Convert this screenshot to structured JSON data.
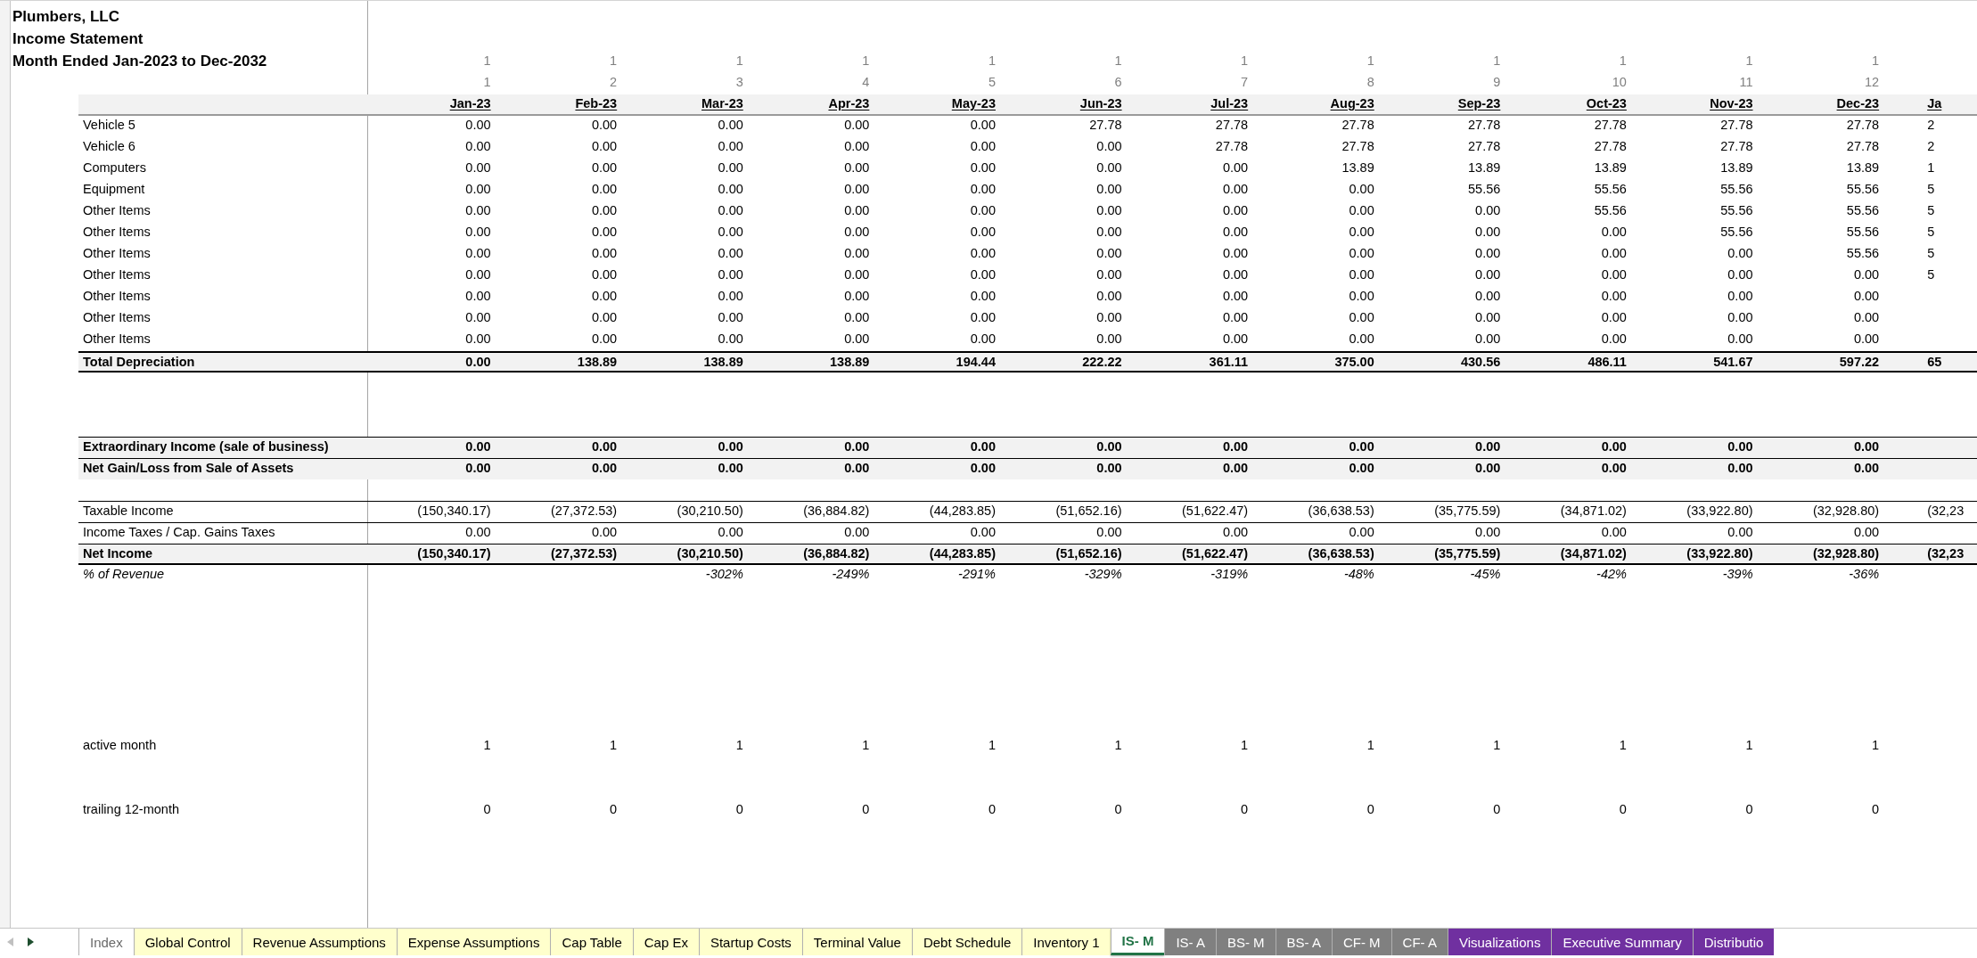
{
  "title_lines": [
    "Plumbers, LLC",
    "Income Statement",
    "Month Ended Jan-2023 to Dec-2032"
  ],
  "sections": [
    {
      "rows": [
        {
          "kind": "index",
          "values": [
            "1",
            "1",
            "1",
            "1",
            "1",
            "1",
            "1",
            "1",
            "1",
            "1",
            "1",
            "1"
          ]
        },
        {
          "kind": "index",
          "values": [
            "1",
            "2",
            "3",
            "4",
            "5",
            "6",
            "7",
            "8",
            "9",
            "10",
            "11",
            "12"
          ]
        },
        {
          "kind": "header",
          "values": [
            "Jan-23",
            "Feb-23",
            "Mar-23",
            "Apr-23",
            "May-23",
            "Jun-23",
            "Jul-23",
            "Aug-23",
            "Sep-23",
            "Oct-23",
            "Nov-23",
            "Dec-23"
          ],
          "cut_value": "Ja"
        }
      ]
    },
    {
      "rows": [
        {
          "kind": "item",
          "label": "Vehicle 5",
          "values": [
            "0.00",
            "0.00",
            "0.00",
            "0.00",
            "0.00",
            "27.78",
            "27.78",
            "27.78",
            "27.78",
            "27.78",
            "27.78",
            "27.78"
          ],
          "cut_value": "2"
        },
        {
          "kind": "item",
          "label": "Vehicle 6",
          "values": [
            "0.00",
            "0.00",
            "0.00",
            "0.00",
            "0.00",
            "0.00",
            "27.78",
            "27.78",
            "27.78",
            "27.78",
            "27.78",
            "27.78"
          ],
          "cut_value": "2"
        },
        {
          "kind": "item",
          "label": "Computers",
          "values": [
            "0.00",
            "0.00",
            "0.00",
            "0.00",
            "0.00",
            "0.00",
            "0.00",
            "13.89",
            "13.89",
            "13.89",
            "13.89",
            "13.89"
          ],
          "cut_value": "1"
        },
        {
          "kind": "item",
          "label": "Equipment",
          "values": [
            "0.00",
            "0.00",
            "0.00",
            "0.00",
            "0.00",
            "0.00",
            "0.00",
            "0.00",
            "55.56",
            "55.56",
            "55.56",
            "55.56"
          ],
          "cut_value": "5"
        },
        {
          "kind": "item",
          "label": "Other Items",
          "values": [
            "0.00",
            "0.00",
            "0.00",
            "0.00",
            "0.00",
            "0.00",
            "0.00",
            "0.00",
            "0.00",
            "55.56",
            "55.56",
            "55.56"
          ],
          "cut_value": "5"
        },
        {
          "kind": "item",
          "label": "Other Items",
          "values": [
            "0.00",
            "0.00",
            "0.00",
            "0.00",
            "0.00",
            "0.00",
            "0.00",
            "0.00",
            "0.00",
            "0.00",
            "55.56",
            "55.56"
          ],
          "cut_value": "5"
        },
        {
          "kind": "item",
          "label": "Other Items",
          "values": [
            "0.00",
            "0.00",
            "0.00",
            "0.00",
            "0.00",
            "0.00",
            "0.00",
            "0.00",
            "0.00",
            "0.00",
            "0.00",
            "55.56"
          ],
          "cut_value": "5"
        },
        {
          "kind": "item",
          "label": "Other Items",
          "values": [
            "0.00",
            "0.00",
            "0.00",
            "0.00",
            "0.00",
            "0.00",
            "0.00",
            "0.00",
            "0.00",
            "0.00",
            "0.00",
            "0.00"
          ],
          "cut_value": "5"
        },
        {
          "kind": "item",
          "label": "Other Items",
          "values": [
            "0.00",
            "0.00",
            "0.00",
            "0.00",
            "0.00",
            "0.00",
            "0.00",
            "0.00",
            "0.00",
            "0.00",
            "0.00",
            "0.00"
          ]
        },
        {
          "kind": "item",
          "label": "Other Items",
          "values": [
            "0.00",
            "0.00",
            "0.00",
            "0.00",
            "0.00",
            "0.00",
            "0.00",
            "0.00",
            "0.00",
            "0.00",
            "0.00",
            "0.00"
          ]
        },
        {
          "kind": "item",
          "label": "Other Items",
          "values": [
            "0.00",
            "0.00",
            "0.00",
            "0.00",
            "0.00",
            "0.00",
            "0.00",
            "0.00",
            "0.00",
            "0.00",
            "0.00",
            "0.00"
          ]
        },
        {
          "kind": "total",
          "label": "Total Depreciation",
          "values": [
            "0.00",
            "138.89",
            "138.89",
            "138.89",
            "194.44",
            "222.22",
            "361.11",
            "375.00",
            "430.56",
            "486.11",
            "541.67",
            "597.22"
          ],
          "cut_value": "65"
        }
      ]
    },
    {
      "rows": [
        {
          "kind": "shaded",
          "label": "Extraordinary Income (sale of business)",
          "values": [
            "0.00",
            "0.00",
            "0.00",
            "0.00",
            "0.00",
            "0.00",
            "0.00",
            "0.00",
            "0.00",
            "0.00",
            "0.00",
            "0.00"
          ]
        },
        {
          "kind": "shaded",
          "label": "Net Gain/Loss from Sale of Assets",
          "values": [
            "0.00",
            "0.00",
            "0.00",
            "0.00",
            "0.00",
            "0.00",
            "0.00",
            "0.00",
            "0.00",
            "0.00",
            "0.00",
            "0.00"
          ]
        }
      ]
    },
    {
      "rows": [
        {
          "kind": "ruled",
          "label": "Taxable Income",
          "values": [
            "(150,340.17)",
            "(27,372.53)",
            "(30,210.50)",
            "(36,884.82)",
            "(44,283.85)",
            "(51,652.16)",
            "(51,622.47)",
            "(36,638.53)",
            "(35,775.59)",
            "(34,871.02)",
            "(33,922.80)",
            "(32,928.80)"
          ],
          "cut_value": "(32,23"
        },
        {
          "kind": "ruled",
          "label": "Income Taxes / Cap. Gains Taxes",
          "values": [
            "0.00",
            "0.00",
            "0.00",
            "0.00",
            "0.00",
            "0.00",
            "0.00",
            "0.00",
            "0.00",
            "0.00",
            "0.00",
            "0.00"
          ]
        },
        {
          "kind": "net",
          "label": "Net Income",
          "values": [
            "(150,340.17)",
            "(27,372.53)",
            "(30,210.50)",
            "(36,884.82)",
            "(44,283.85)",
            "(51,652.16)",
            "(51,622.47)",
            "(36,638.53)",
            "(35,775.59)",
            "(34,871.02)",
            "(33,922.80)",
            "(32,928.80)"
          ],
          "cut_value": "(32,23"
        },
        {
          "kind": "percent",
          "label": "% of Revenue",
          "values": [
            "-302%",
            "-249%",
            "-291%",
            "-329%",
            "-319%",
            "-48%",
            "-45%",
            "-42%",
            "-39%",
            "-36%"
          ]
        }
      ]
    },
    {
      "rows": [
        {
          "kind": "item",
          "label": "active month",
          "values": [
            "1",
            "1",
            "1",
            "1",
            "1",
            "1",
            "1",
            "1",
            "1",
            "1",
            "1",
            "1"
          ]
        }
      ]
    },
    {
      "rows": [
        {
          "kind": "item",
          "label": "trailing 12-month",
          "values": [
            "0",
            "0",
            "0",
            "0",
            "0",
            "0",
            "0",
            "0",
            "0",
            "0",
            "0",
            "0"
          ]
        }
      ]
    }
  ],
  "tabs": [
    {
      "label": "Index",
      "color": "#ffffff",
      "selected": false
    },
    {
      "label": "Global Control",
      "color": "#ffffcc",
      "selected": false
    },
    {
      "label": "Revenue Assumptions",
      "color": "#ffffcc",
      "selected": false
    },
    {
      "label": "Expense Assumptions",
      "color": "#ffffcc",
      "selected": false
    },
    {
      "label": "Cap Table",
      "color": "#ffffcc",
      "selected": false
    },
    {
      "label": "Cap Ex",
      "color": "#ffffcc",
      "selected": false
    },
    {
      "label": "Startup Costs",
      "color": "#ffffcc",
      "selected": false
    },
    {
      "label": "Terminal Value",
      "color": "#ffffcc",
      "selected": false
    },
    {
      "label": "Debt Schedule",
      "color": "#ffffcc",
      "selected": false
    },
    {
      "label": "Inventory 1",
      "color": "#ffffcc",
      "selected": false
    },
    {
      "label": "IS- M",
      "color": "#ffffff",
      "selected": true
    },
    {
      "label": "IS- A",
      "color": "#808080",
      "selected": false
    },
    {
      "label": "BS- M",
      "color": "#808080",
      "selected": false
    },
    {
      "label": "BS- A",
      "color": "#808080",
      "selected": false
    },
    {
      "label": "CF- M",
      "color": "#808080",
      "selected": false
    },
    {
      "label": "CF- A",
      "color": "#808080",
      "selected": false
    },
    {
      "label": "Visualizations",
      "color": "#7030a0",
      "selected": false
    },
    {
      "label": "Executive Summary",
      "color": "#7030a0",
      "selected": false
    },
    {
      "label": "Distributio",
      "color": "#7030a0",
      "selected": false
    }
  ]
}
